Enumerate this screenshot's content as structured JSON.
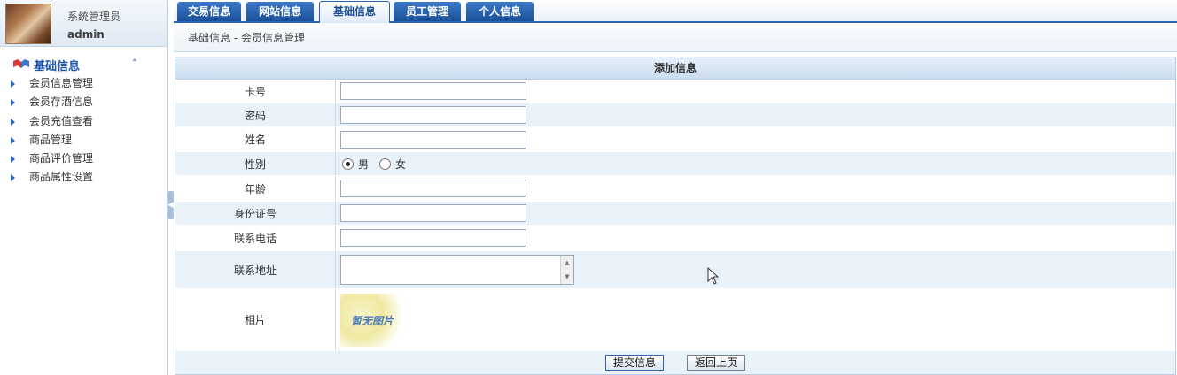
{
  "user": {
    "role": "系统管理员",
    "name": "admin"
  },
  "sidebar": {
    "header": "基础信息",
    "items": [
      {
        "label": "会员信息管理"
      },
      {
        "label": "会员存酒信息"
      },
      {
        "label": "会员充值查看"
      },
      {
        "label": "商品管理"
      },
      {
        "label": "商品评价管理"
      },
      {
        "label": "商品属性设置"
      }
    ]
  },
  "tabs": [
    {
      "label": "交易信息",
      "active": false
    },
    {
      "label": "网站信息",
      "active": false
    },
    {
      "label": "基础信息",
      "active": true
    },
    {
      "label": "员工管理",
      "active": false
    },
    {
      "label": "个人信息",
      "active": false
    }
  ],
  "breadcrumb": "基础信息  -  会员信息管理",
  "form": {
    "title": "添加信息",
    "card_label": "卡号",
    "password_label": "密码",
    "name_label": "姓名",
    "gender_label": "性别",
    "gender_male": "男",
    "gender_female": "女",
    "age_label": "年龄",
    "id_label": "身份证号",
    "phone_label": "联系电话",
    "address_label": "联系地址",
    "photo_label": "相片",
    "photo_placeholder": "暂无图片"
  },
  "buttons": {
    "submit": "提交信息",
    "back": "返回上页"
  },
  "colors": {
    "accent": "#2b63b0",
    "row_alt": "#e9f1f9",
    "sidebar_head": "#1e55a8"
  }
}
